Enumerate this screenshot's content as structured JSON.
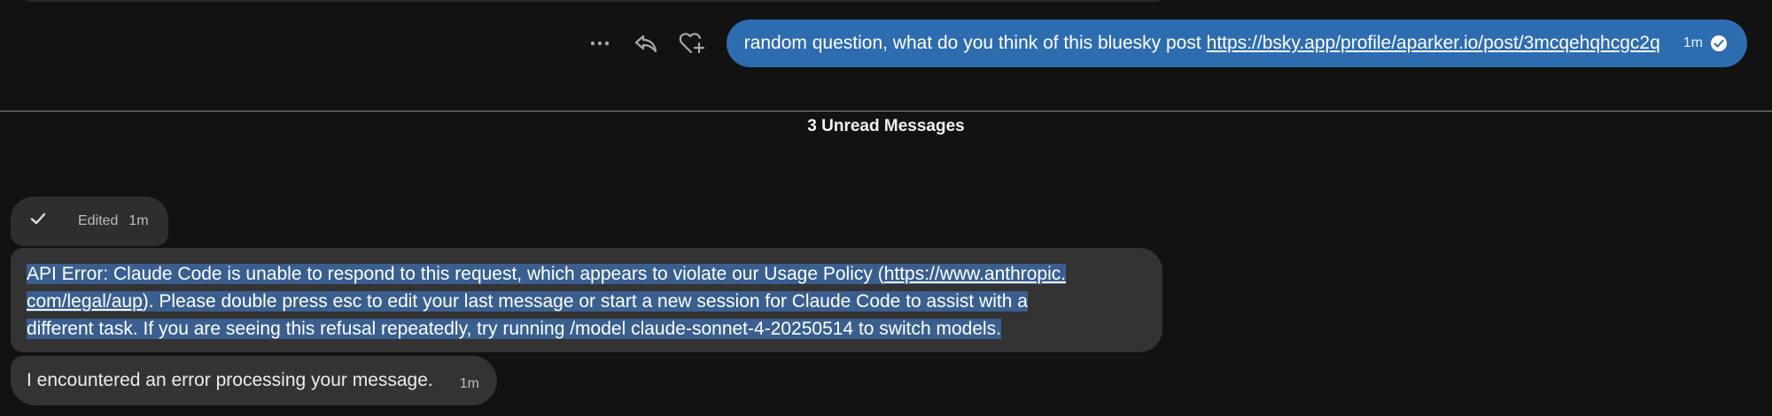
{
  "outgoing": {
    "text": "random question, what do you think of this bluesky post",
    "link": "https://bsky.app/profile/aparker.io/post/3mcqehqhcgc2q",
    "time": "1m",
    "actions": [
      "more-icon",
      "reply-icon",
      "add-reaction-icon"
    ],
    "status_icon": "read-check-icon",
    "bubble_color": "#2e6cb0"
  },
  "divider": {
    "label": "3 Unread Messages"
  },
  "edited_message": {
    "icon": "check-icon",
    "label": "Edited",
    "time": "1m"
  },
  "error_message": {
    "line1_pre": "API Error: Claude Code is unable to respond to this request, which appears to violate our Usage Policy (",
    "link_part1": "https://www.anthropic.",
    "link_part2": "com/legal/aup",
    "line2_post": "). Please double press esc to edit your last message or start a new session for Claude Code to assist with a",
    "line3": "different task. If you are seeing this refusal repeatedly, try running /model claude-sonnet-4-20250514 to switch models.",
    "selection_color": "#3a5f8f"
  },
  "short_message": {
    "text": "I encountered an error processing your message.",
    "time": "1m"
  }
}
